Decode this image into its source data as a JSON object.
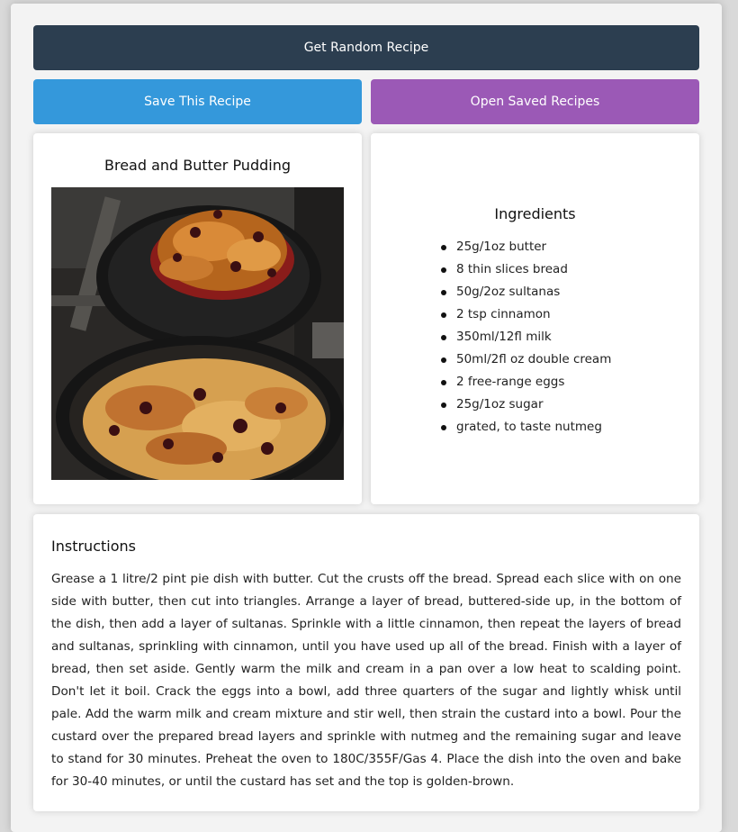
{
  "buttons": {
    "random": "Get Random Recipe",
    "save": "Save This Recipe",
    "open_saved": "Open Saved Recipes"
  },
  "colors": {
    "random_button": "#2c3e50",
    "save_button": "#3498db",
    "open_button": "#9b59b6"
  },
  "recipe": {
    "title": "Bread and Butter Pudding",
    "image_icon": "food-photo"
  },
  "ingredients": {
    "heading": "Ingredients",
    "items": [
      "25g/1oz butter",
      "8 thin slices bread",
      "50g/2oz sultanas",
      "2 tsp cinnamon",
      "350ml/12fl milk",
      "50ml/2fl oz double cream",
      "2 free-range eggs",
      "25g/1oz sugar",
      "grated, to taste nutmeg"
    ]
  },
  "instructions": {
    "heading": "Instructions",
    "text": "Grease a 1 litre/2 pint pie dish with butter. Cut the crusts off the bread. Spread each slice with on one side with butter, then cut into triangles. Arrange a layer of bread, buttered-side up, in the bottom of the dish, then add a layer of sultanas. Sprinkle with a little cinnamon, then repeat the layers of bread and sultanas, sprinkling with cinnamon, until you have used up all of the bread. Finish with a layer of bread, then set aside. Gently warm the milk and cream in a pan over a low heat to scalding point. Don't let it boil. Crack the eggs into a bowl, add three quarters of the sugar and lightly whisk until pale. Add the warm milk and cream mixture and stir well, then strain the custard into a bowl. Pour the custard over the prepared bread layers and sprinkle with nutmeg and the remaining sugar and leave to stand for 30 minutes. Preheat the oven to 180C/355F/Gas 4. Place the dish into the oven and bake for 30-40 minutes, or until the custard has set and the top is golden-brown."
  }
}
